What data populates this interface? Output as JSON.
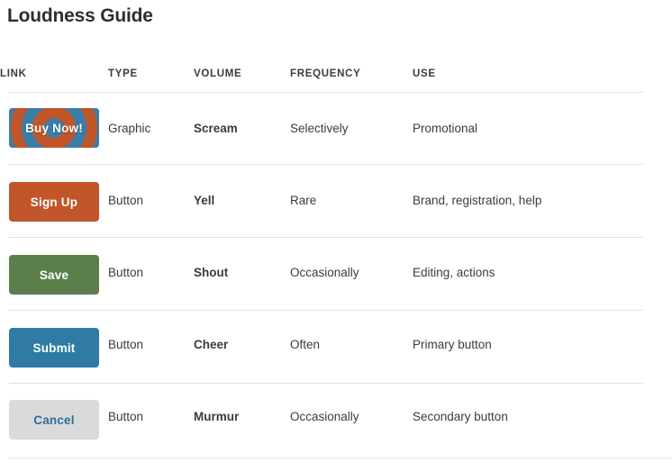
{
  "page": {
    "title": "Loudness Guide"
  },
  "table": {
    "headers": {
      "link": "LINK",
      "type": "TYPE",
      "volume": "VOLUME",
      "frequency": "FREQUENCY",
      "use": "USE"
    },
    "rows": [
      {
        "button_label": "Buy Now!",
        "button_style": "graphic-bullseye",
        "type": "Graphic",
        "volume": "Scream",
        "frequency": "Selectively",
        "use": "Promotional"
      },
      {
        "button_label": "Sign Up",
        "button_style": "orange",
        "type": "Button",
        "volume": "Yell",
        "frequency": "Rare",
        "use": "Brand, registration, help"
      },
      {
        "button_label": "Save",
        "button_style": "green",
        "type": "Button",
        "volume": "Shout",
        "frequency": "Occasionally",
        "use": "Editing, actions"
      },
      {
        "button_label": "Submit",
        "button_style": "blue",
        "type": "Button",
        "volume": "Cheer",
        "frequency": "Often",
        "use": "Primary button"
      },
      {
        "button_label": "Cancel",
        "button_style": "gray",
        "type": "Button",
        "volume": "Murmur",
        "frequency": "Occasionally",
        "use": "Secondary button"
      }
    ]
  },
  "colors": {
    "graphic_blue": "#3c7ca8",
    "graphic_orange": "#c0562a",
    "orange": "#c0562a",
    "green": "#5b7f4b",
    "blue": "#2f7ba6",
    "gray": "#d9dbdb",
    "gray_text": "#2f6f97",
    "divider": "#e2e2e2",
    "text": "#3b3b3b",
    "title": "#2e2e2e"
  }
}
